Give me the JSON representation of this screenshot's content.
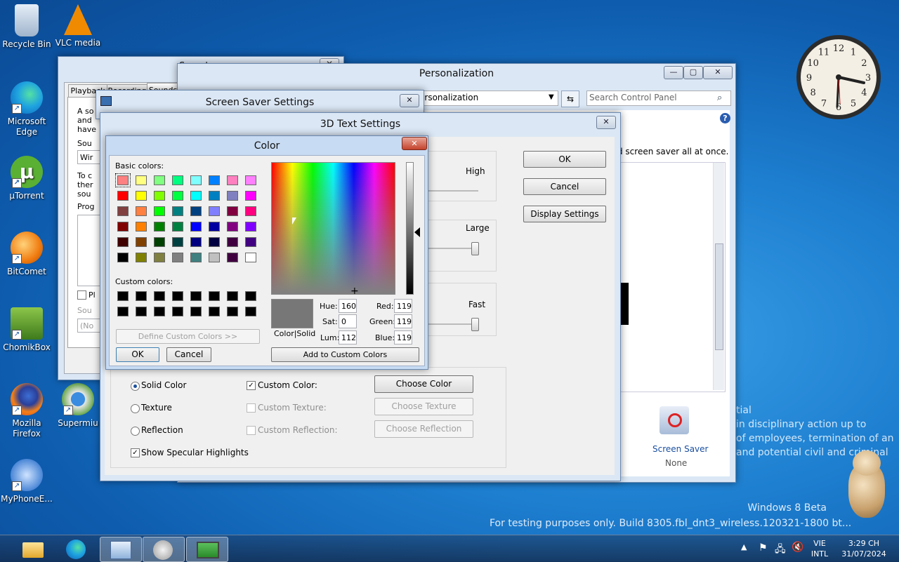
{
  "desktop": {
    "icons": [
      {
        "label": "Recycle Bin"
      },
      {
        "label": "VLC media"
      },
      {
        "label": "Microsoft Edge"
      },
      {
        "label": "µTorrent"
      },
      {
        "label": "BitComet"
      },
      {
        "label": "ChomikBox"
      },
      {
        "label": "Mozilla Firefox"
      },
      {
        "label": "Supermiu"
      },
      {
        "label": "MyPhoneE..."
      }
    ],
    "watermark": {
      "line1": "Windows 8 Beta",
      "line2": "For testing purposes only. Build 8305.fbl_dnt3_wireless.120321-1800 bt..."
    },
    "wallpaper_text": [
      "tial",
      "in disciplinary action up to",
      "of employees, termination of an",
      "and potential civil and criminal"
    ]
  },
  "sound_window": {
    "title": "Sound",
    "tabs": [
      "Playback",
      "Recording",
      "Sounds"
    ],
    "text_lines": [
      "A so",
      "and",
      "have",
      "Sou",
      "Wir",
      "To c",
      "ther",
      "sou",
      "Prog",
      "Pl",
      "Sou",
      "(No"
    ]
  },
  "personalization": {
    "title": "Personalization",
    "address": "ersonalization",
    "search_placeholder": "Search Control Panel",
    "partial_text": "d screen saver all at once.",
    "screen_saver_link": "Screen Saver",
    "screen_saver_value": "None"
  },
  "screen_saver_settings": {
    "title": "Screen Saver Settings"
  },
  "text3d": {
    "title": "3D Text Settings",
    "ok": "OK",
    "cancel": "Cancel",
    "display_settings": "Display Settings",
    "resolution_high": "High",
    "size_large": "Large",
    "speed_fast": "Fast",
    "solid_color": "Solid Color",
    "texture": "Texture",
    "reflection": "Reflection",
    "custom_color": "Custom Color:",
    "custom_texture": "Custom Texture:",
    "custom_reflection": "Custom Reflection:",
    "choose_color": "Choose Color",
    "choose_texture": "Choose Texture",
    "choose_reflection": "Choose Reflection",
    "specular": "Show Specular Highlights"
  },
  "color_dialog": {
    "title": "Color",
    "basic_colors_label": "Basic colors:",
    "custom_colors_label": "Custom colors:",
    "define_custom": "Define Custom Colors >>",
    "ok": "OK",
    "cancel": "Cancel",
    "add_custom": "Add to Custom Colors",
    "color_solid": "Color|Solid",
    "hue_label": "Hue:",
    "hue": "160",
    "sat_label": "Sat:",
    "sat": "0",
    "lum_label": "Lum:",
    "lum": "112",
    "red_label": "Red:",
    "red": "119",
    "green_label": "Green:",
    "green": "119",
    "blue_label": "Blue:",
    "blue": "119",
    "preview_color": "#777777",
    "basic_colors": [
      "#ff8080",
      "#ffff80",
      "#80ff80",
      "#00ff80",
      "#80ffff",
      "#0080ff",
      "#ff80c0",
      "#ff80ff",
      "#ff0000",
      "#ffff00",
      "#80ff00",
      "#00ff40",
      "#00ffff",
      "#0080c0",
      "#8080c0",
      "#ff00ff",
      "#804040",
      "#ff8040",
      "#00ff00",
      "#008080",
      "#004080",
      "#8080ff",
      "#800040",
      "#ff0080",
      "#800000",
      "#ff8000",
      "#008000",
      "#008040",
      "#0000ff",
      "#0000a0",
      "#800080",
      "#8000ff",
      "#400000",
      "#804000",
      "#004000",
      "#004040",
      "#000080",
      "#000040",
      "#400040",
      "#400080",
      "#000000",
      "#808000",
      "#808040",
      "#808080",
      "#408080",
      "#c0c0c0",
      "#400040",
      "#ffffff"
    ]
  },
  "taskbar": {
    "lang1": "VIE",
    "lang2": "INTL",
    "time": "3:29 CH",
    "date": "31/07/2024"
  },
  "clock": {
    "numerals": [
      "12",
      "1",
      "2",
      "3",
      "4",
      "5",
      "6",
      "7",
      "8",
      "9",
      "10",
      "11"
    ]
  }
}
